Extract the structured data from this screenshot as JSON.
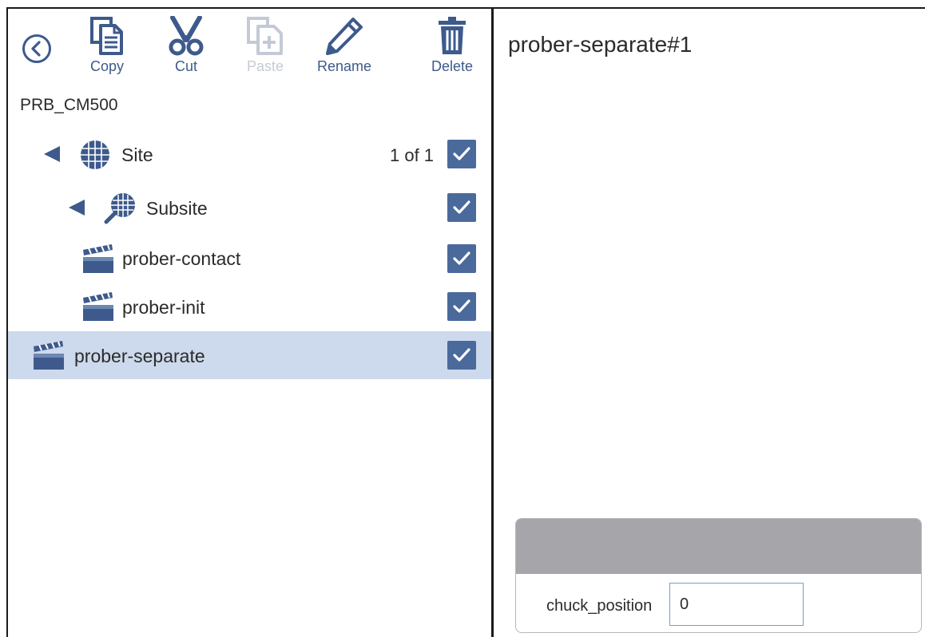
{
  "toolbar": {
    "back_icon": "back-circle-icon",
    "copy_label": "Copy",
    "cut_label": "Cut",
    "paste_label": "Paste",
    "rename_label": "Rename",
    "delete_label": "Delete"
  },
  "tree": {
    "root": "PRB_CM500",
    "site": {
      "label": "Site",
      "count": "1 of 1",
      "checked": true
    },
    "subsite": {
      "label": "Subsite",
      "checked": true
    },
    "items": [
      {
        "label": "prober-contact",
        "checked": true
      },
      {
        "label": "prober-init",
        "checked": true
      },
      {
        "label": "prober-separate",
        "checked": true,
        "selected": true
      }
    ]
  },
  "detail": {
    "title": "prober-separate#1",
    "param_label": "chuck_position",
    "param_value": "0"
  },
  "colors": {
    "accent": "#3e5a8c",
    "checkbox": "#4a6a9c",
    "selected_row": "#cdd9ec",
    "panel_header": "#a6a5a9",
    "disabled": "#c4cad5"
  }
}
